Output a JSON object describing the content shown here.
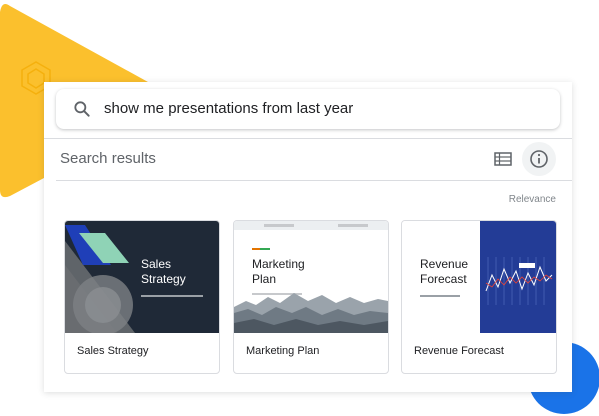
{
  "search": {
    "query": "show me presentations from last year"
  },
  "results": {
    "heading": "Search results",
    "sort_label": "Relevance"
  },
  "cards": [
    {
      "title": "Sales Strategy",
      "thumb_line1": "Sales",
      "thumb_line2": "Strategy"
    },
    {
      "title": "Marketing Plan",
      "thumb_line1": "Marketing",
      "thumb_line2": "Plan"
    },
    {
      "title": "Revenue Forecast",
      "thumb_line1": "Revenue",
      "thumb_line2": "Forecast"
    }
  ],
  "icons": {
    "search": "search-icon",
    "list_view": "list-view-icon",
    "info": "info-icon"
  },
  "colors": {
    "yellow_accent": "#fbbc04",
    "blue_accent": "#1a73e8",
    "deck_dark": "#1f2937",
    "deck_navy": "#233c96",
    "teal": "#8fd3b6"
  }
}
